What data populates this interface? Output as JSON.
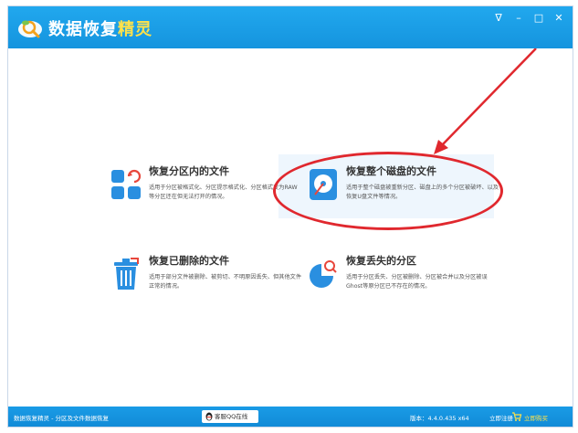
{
  "app": {
    "title_main": "数据恢复",
    "title_accent": "精灵",
    "controls": {
      "pin": "∇",
      "minimize": "–",
      "maximize": "□",
      "close": "✕"
    }
  },
  "cards": [
    {
      "title": "恢复分区内的文件",
      "desc": "适用于分区被格式化、分区提示格式化、分区格式变为RAW等分区还在但无法打开的情况。",
      "icon": "partition-tiles-icon"
    },
    {
      "title": "恢复整个磁盘的文件",
      "desc": "适用于整个磁盘被重新分区、磁盘上的多个分区被破坏、以及恢复U盘文件等情况。",
      "icon": "disk-icon"
    },
    {
      "title": "恢复已删除的文件",
      "desc": "适用于部分文件被删除、被剪切、不明原因丢失、但其他文件正常的情况。",
      "icon": "recycle-bin-icon"
    },
    {
      "title": "恢复丢失的分区",
      "desc": "适用于分区丢失、分区被删除、分区被合并以及分区被误Ghost等原分区已不存在的情况。",
      "icon": "pie-search-icon"
    }
  ],
  "statusbar": {
    "left_text": "数据恢复精灵 - 分区及文件数据恢复",
    "qq_label": "客服QQ在线",
    "version": "版本：4.4.0.435 x64",
    "register": "立即注册",
    "buy": "立即购买"
  },
  "colors": {
    "titlebar": "#1a9de8",
    "accent_title": "#ffe24a",
    "annotation": "#e0282e",
    "icon_blue": "#2a8fe0"
  }
}
